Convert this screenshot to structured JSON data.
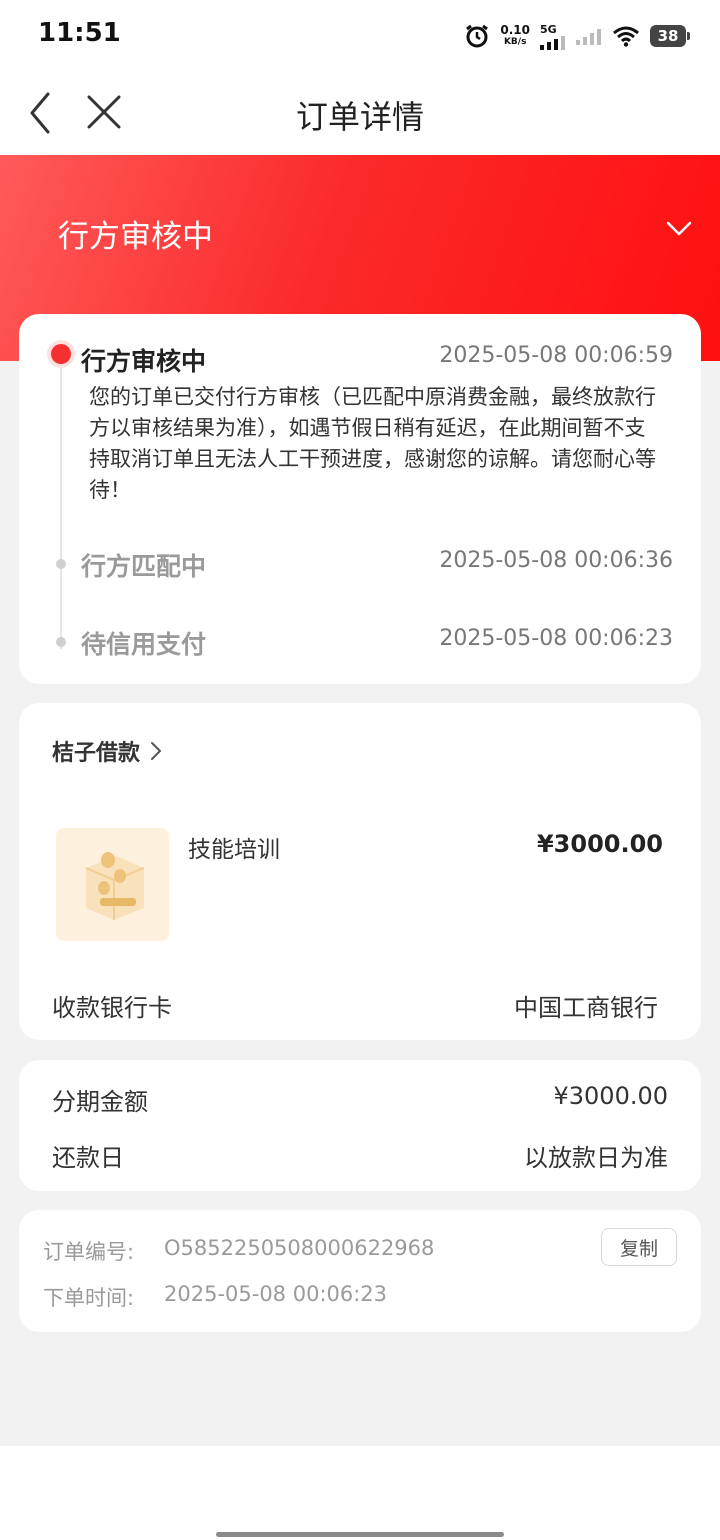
{
  "status_bar": {
    "time": "11:51",
    "speed_value": "0.10",
    "speed_unit": "KB/s",
    "network": "5G",
    "battery": "38"
  },
  "nav": {
    "title": "订单详情",
    "back_icon": "chevron-left-icon",
    "close_icon": "close-icon"
  },
  "banner": {
    "status": "行方审核中",
    "expand_icon": "chevron-down-icon",
    "color": "#ff1a1a"
  },
  "timeline": [
    {
      "title": "行方审核中",
      "time": "2025-05-08 00:06:59",
      "description": "您的订单已交付行方审核（已匹配中原消费金融，最终放款行方以审核结果为准），如遇节假日稍有延迟，在此期间暂不支持取消订单且无法人工干预进度，感谢您的谅解。请您耐心等待！"
    },
    {
      "title": "行方匹配中",
      "time": "2025-05-08 00:06:36"
    },
    {
      "title": "待信用支付",
      "time": "2025-05-08 00:06:23"
    }
  ],
  "product_card": {
    "merchant": "桔子借款",
    "product_name": "技能培训",
    "price": "¥3000.00",
    "bank_label": "收款银行卡",
    "bank_value": "中国工商银行"
  },
  "installment": {
    "amount_label": "分期金额",
    "amount_value": "¥3000.00",
    "repay_label": "还款日",
    "repay_value": "以放款日为准"
  },
  "order_info": {
    "number_label": "订单编号:",
    "number_value": "O585225050800062296​8",
    "copy_label": "复制",
    "time_label": "下单时间:",
    "time_value": "2025-05-08 00:06:23"
  }
}
